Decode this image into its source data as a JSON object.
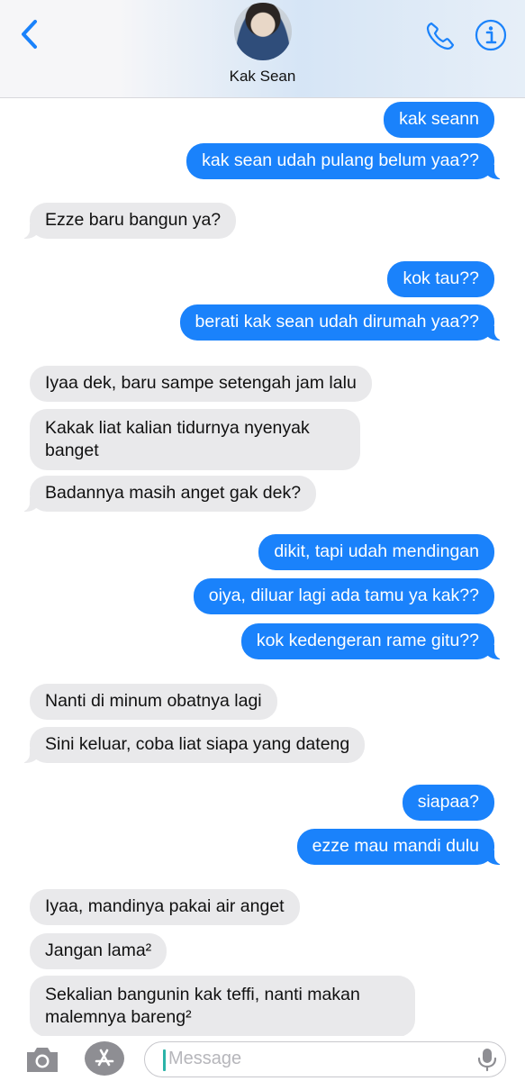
{
  "header": {
    "contact_name": "Kak Sean",
    "accent_color": "#1a82fb",
    "icons": [
      "chevron-left-icon",
      "phone-icon",
      "info-icon"
    ]
  },
  "messages": [
    {
      "side": "out",
      "text": "kak seann"
    },
    {
      "side": "out",
      "text": "kak sean udah pulang belum yaa??"
    },
    {
      "side": "in",
      "text": "Ezze baru bangun ya?"
    },
    {
      "side": "out",
      "text": "kok tau??"
    },
    {
      "side": "out",
      "text": "berati kak sean udah dirumah yaa??"
    },
    {
      "side": "in",
      "text": "Iyaa dek, baru sampe setengah jam lalu"
    },
    {
      "side": "in",
      "text": "Kakak liat kalian tidurnya nyenyak banget"
    },
    {
      "side": "in",
      "text": "Badannya masih anget gak dek?"
    },
    {
      "side": "out",
      "text": "dikit, tapi udah mendingan"
    },
    {
      "side": "out",
      "text": "oiya, diluar lagi ada tamu ya kak??"
    },
    {
      "side": "out",
      "text": "kok kedengeran rame gitu??"
    },
    {
      "side": "in",
      "text": "Nanti di minum obatnya lagi"
    },
    {
      "side": "in",
      "text": "Sini keluar, coba liat siapa yang dateng"
    },
    {
      "side": "out",
      "text": "siapaa?"
    },
    {
      "side": "out",
      "text": "ezze mau mandi dulu"
    },
    {
      "side": "in",
      "text": "Iyaa, mandinya pakai air anget"
    },
    {
      "side": "in",
      "text": "Jangan lama²"
    },
    {
      "side": "in",
      "text": "Sekalian bangunin kak teffi, nanti makan malemnya bareng²"
    }
  ],
  "composer": {
    "placeholder": "Message",
    "icons": [
      "camera-icon",
      "app-store-icon",
      "microphone-icon"
    ]
  }
}
